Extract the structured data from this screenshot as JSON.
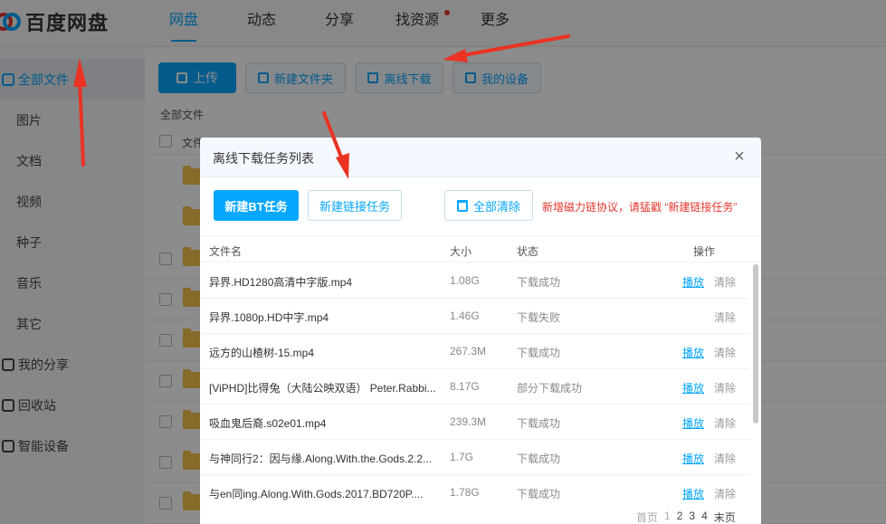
{
  "app": {
    "logo_text": "百度网盘",
    "nav": [
      {
        "label": "网盘",
        "active": true
      },
      {
        "label": "动态"
      },
      {
        "label": "分享"
      },
      {
        "label": "找资源",
        "badge_dot": true
      },
      {
        "label": "更多"
      }
    ]
  },
  "sidebar": {
    "items": [
      {
        "label": "全部文件",
        "active": true,
        "icon": "folder-icon"
      },
      {
        "label": "图片"
      },
      {
        "label": "文档"
      },
      {
        "label": "视频"
      },
      {
        "label": "种子"
      },
      {
        "label": "音乐"
      },
      {
        "label": "其它"
      },
      {
        "label": "我的分享",
        "icon": "share-icon"
      },
      {
        "label": "回收站",
        "icon": "trash-icon"
      },
      {
        "label": "智能设备",
        "icon": "device-icon"
      }
    ]
  },
  "toolbar": {
    "upload": "上传",
    "new_folder": "新建文件夹",
    "offline_download": "离线下载",
    "my_devices": "我的设备"
  },
  "breadcrumb": "全部文件",
  "file_list": {
    "header": "文件名"
  },
  "dialog": {
    "title": "离线下载任务列表",
    "close": "×",
    "new_bt": "新建BT任务",
    "new_link": "新建链接任务",
    "clear_all": "全部清除",
    "notice": "新增磁力链协议，请猛戳 “新建链接任务”",
    "columns": {
      "name": "文件名",
      "size": "大小",
      "status": "状态",
      "actions": "操作"
    },
    "rows": [
      {
        "name": "异界.HD1280高清中字版.mp4",
        "size": "1.08G",
        "status": "下载成功",
        "play": "播放",
        "clear": "清除"
      },
      {
        "name": "异界.1080p.HD中字.mp4",
        "size": "1.46G",
        "status": "下载失败",
        "play": "",
        "clear": "清除"
      },
      {
        "name": "远方的山楂树-15.mp4",
        "size": "267.3M",
        "status": "下载成功",
        "play": "播放",
        "clear": "清除"
      },
      {
        "name": "[ViPHD]比得兔（大陆公映双语） Peter.Rabbi...",
        "size": "8.17G",
        "status": "部分下载成功",
        "play": "播放",
        "clear": "清除"
      },
      {
        "name": "吸血鬼后裔.s02e01.mp4",
        "size": "239.3M",
        "status": "下载成功",
        "play": "播放",
        "clear": "清除"
      },
      {
        "name": "与神同行2：因与缘.Along.With.the.Gods.2.2...",
        "size": "1.7G",
        "status": "下载成功",
        "play": "播放",
        "clear": "清除"
      },
      {
        "name": "与en同ing.Along.With.Gods.2017.BD720P....",
        "size": "1.78G",
        "status": "下载成功",
        "play": "播放",
        "clear": "清除"
      }
    ],
    "pager": {
      "first": "首页",
      "pages": [
        "1",
        "2",
        "3",
        "4"
      ],
      "last": "末页"
    }
  },
  "colors": {
    "accent": "#06a7ff",
    "warning": "#e6352b",
    "folder": "#f5c24b"
  }
}
